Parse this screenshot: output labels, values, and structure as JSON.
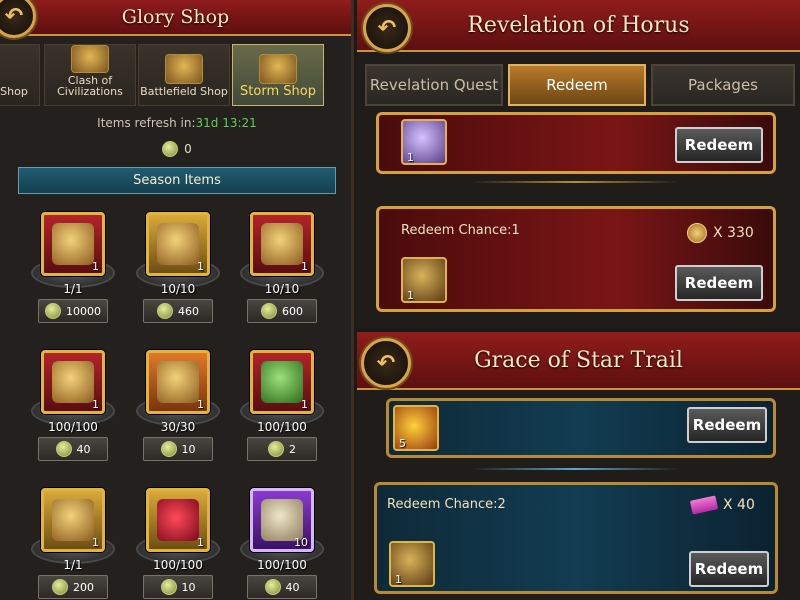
{
  "glory": {
    "title": "Glory Shop",
    "back_icon": "back-arrow-icon",
    "tabs": [
      {
        "label": "Shop",
        "active": false
      },
      {
        "label": "Clash of Civilizations",
        "active": false
      },
      {
        "label": "Battlefield Shop",
        "active": false
      },
      {
        "label": "Storm Shop",
        "active": true
      }
    ],
    "refresh_label": "Items refresh in:",
    "refresh_time": "31d 13:21",
    "currency_amount": "0",
    "section_title": "Season Items",
    "items": [
      {
        "icon": "treasure-chest-icon",
        "count": "1",
        "stock": "1/1",
        "price": "10000"
      },
      {
        "icon": "gold-chest-icon",
        "count": "1",
        "stock": "10/10",
        "price": "460"
      },
      {
        "icon": "star-emblem-icon",
        "count": "1",
        "stock": "10/10",
        "price": "600"
      },
      {
        "icon": "red-chest-icon",
        "count": "1",
        "stock": "100/100",
        "price": "40"
      },
      {
        "icon": "scroll-puzzle-icon",
        "count": "1",
        "stock": "30/30",
        "price": "10"
      },
      {
        "icon": "green-dragon-icon",
        "count": "1",
        "stock": "100/100",
        "price": "2"
      },
      {
        "icon": "scroll-shield-icon",
        "count": "1",
        "stock": "1/1",
        "price": "200"
      },
      {
        "icon": "winged-heart-icon",
        "count": "1",
        "stock": "100/100",
        "price": "10"
      },
      {
        "icon": "purple-scroll-icon",
        "count": "10",
        "stock": "100/100",
        "price": "40"
      }
    ]
  },
  "horus": {
    "title": "Revelation of Horus",
    "back_icon": "back-arrow-icon",
    "tabs": [
      {
        "label": "Revelation Quest",
        "active": false
      },
      {
        "label": "Redeem",
        "active": true
      },
      {
        "label": "Packages",
        "active": false
      }
    ],
    "card1": {
      "icon": "purple-gem-icon",
      "count": "1",
      "button": "Redeem"
    },
    "card2": {
      "chance": "Redeem Chance:1",
      "cost": "X 330",
      "cost_icon": "gold-coin-icon",
      "icon": "scroll-shield-icon",
      "count": "1",
      "button": "Redeem"
    }
  },
  "grace": {
    "title": "Grace of Star Trail",
    "back_icon": "back-arrow-icon",
    "card1": {
      "icon": "flame-drop-icon",
      "count": "5",
      "button": "Redeem"
    },
    "card2": {
      "chance": "Redeem Chance:2",
      "cost": "X 40",
      "cost_icon": "pink-ticket-icon",
      "icon": "scroll-shield-icon",
      "count": "1",
      "button": "Redeem"
    }
  }
}
